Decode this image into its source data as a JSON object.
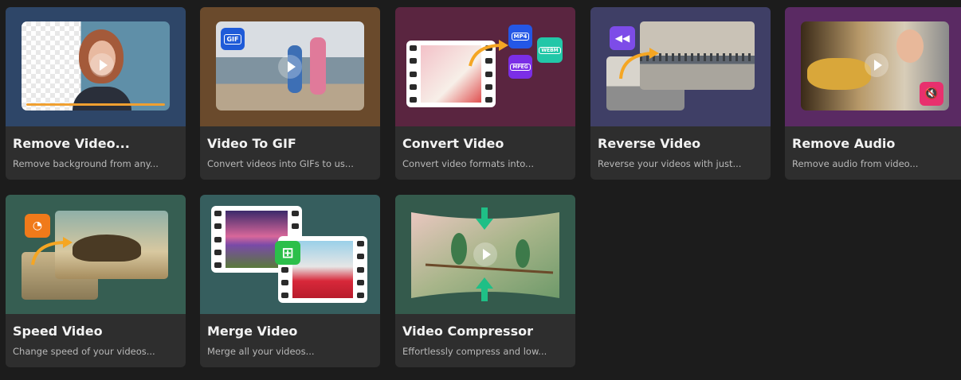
{
  "tools": [
    {
      "title": "Remove Video...",
      "desc": "Remove background from any...",
      "bg": "#2e4668"
    },
    {
      "title": "Video To GIF",
      "desc": "Convert videos into GIFs to us...",
      "bg": "#6a4a2c",
      "badge": "GIF"
    },
    {
      "title": "Convert Video",
      "desc": "Convert video formats into...",
      "bg": "#5a2540",
      "formats": [
        "MP4",
        "MPEG",
        "WEBM"
      ]
    },
    {
      "title": "Reverse Video",
      "desc": "Reverse your videos with just...",
      "bg": "#3f3f66"
    },
    {
      "title": "Remove Audio",
      "desc": "Remove audio from video...",
      "bg": "#5a2a63"
    },
    {
      "title": "Speed Video",
      "desc": "Change speed of your videos...",
      "bg": "#365e52"
    },
    {
      "title": "Merge Video",
      "desc": "Merge all your videos...",
      "bg": "#365e5e"
    },
    {
      "title": "Video Compressor",
      "desc": "Effortlessly compress and low...",
      "bg": "#345a4c"
    }
  ],
  "colors": {
    "page_bg": "#1c1c1c",
    "card_bg": "#2e2e2e",
    "arrow_orange": "#f5a623",
    "gif_blue": "#1f5bd8",
    "mp4_blue": "#2457e6",
    "mpeg_purple": "#7b2ee6",
    "webm_teal": "#22c7a8",
    "reverse_purple": "#7d4ce8",
    "mute_pink": "#e8306e",
    "speed_orange": "#f07a1a",
    "merge_green": "#2bbf4a",
    "compress_green": "#1fbf86"
  }
}
